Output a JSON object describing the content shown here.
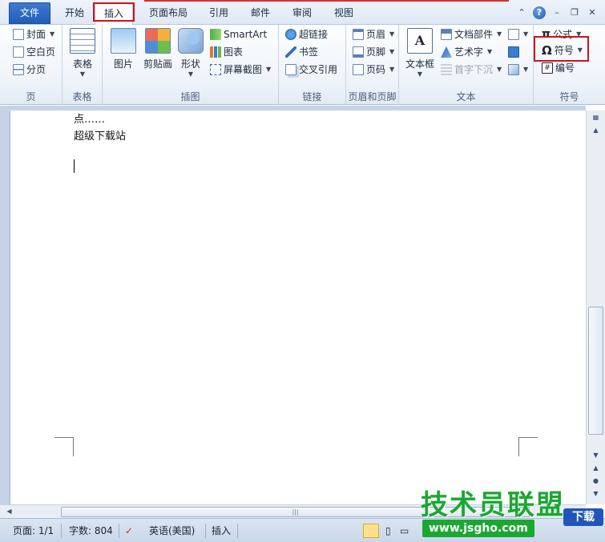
{
  "tabs": [
    {
      "label": "文件"
    },
    {
      "label": "开始"
    },
    {
      "label": "插入"
    },
    {
      "label": "页面布局"
    },
    {
      "label": "引用"
    },
    {
      "label": "邮件"
    },
    {
      "label": "审阅"
    },
    {
      "label": "视图"
    }
  ],
  "groups": {
    "page": {
      "label": "页",
      "items": [
        "封面",
        "空白页",
        "分页"
      ]
    },
    "table": {
      "label": "表格",
      "button": "表格"
    },
    "illustrations": {
      "label": "插图",
      "picture": "图片",
      "clipart": "剪贴画",
      "shapes": "形状",
      "smartart": "SmartArt",
      "chart": "图表",
      "screenshot": "屏幕截图"
    },
    "links": {
      "label": "链接",
      "hyperlink": "超链接",
      "bookmark": "书签",
      "crossref": "交叉引用"
    },
    "header_footer": {
      "label": "页眉和页脚",
      "header": "页眉",
      "footer": "页脚",
      "pagenum": "页码"
    },
    "text": {
      "label": "文本",
      "textbox": "文本框",
      "quickparts": "文档部件",
      "wordart": "艺术字",
      "dropcap": "首字下沉"
    },
    "symbols": {
      "label": "符号",
      "equation": "公式",
      "symbol": "符号",
      "number": "编号"
    }
  },
  "document": {
    "lines": [
      "点……",
      "超级下载站"
    ]
  },
  "status": {
    "page": "页面: 1/1",
    "words": "字数: 804",
    "language": "英语(美国)",
    "mode": "插入"
  },
  "watermark": {
    "title": "技术员联盟",
    "url": "www.jsgho.com",
    "badge": "下载"
  },
  "colors": {
    "highlight": "#d0111b",
    "file_tab": "#2a68c2",
    "watermark_green": "#1aa832"
  }
}
